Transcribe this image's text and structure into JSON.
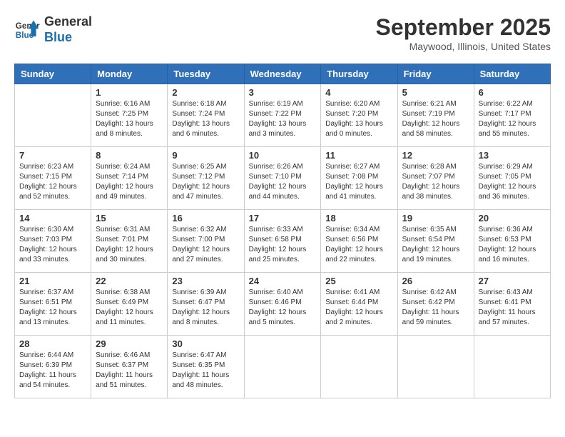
{
  "logo": {
    "line1": "General",
    "line2": "Blue"
  },
  "title": "September 2025",
  "location": "Maywood, Illinois, United States",
  "days_of_week": [
    "Sunday",
    "Monday",
    "Tuesday",
    "Wednesday",
    "Thursday",
    "Friday",
    "Saturday"
  ],
  "weeks": [
    [
      {
        "day": "",
        "info": ""
      },
      {
        "day": "1",
        "info": "Sunrise: 6:16 AM\nSunset: 7:25 PM\nDaylight: 13 hours\nand 8 minutes."
      },
      {
        "day": "2",
        "info": "Sunrise: 6:18 AM\nSunset: 7:24 PM\nDaylight: 13 hours\nand 6 minutes."
      },
      {
        "day": "3",
        "info": "Sunrise: 6:19 AM\nSunset: 7:22 PM\nDaylight: 13 hours\nand 3 minutes."
      },
      {
        "day": "4",
        "info": "Sunrise: 6:20 AM\nSunset: 7:20 PM\nDaylight: 13 hours\nand 0 minutes."
      },
      {
        "day": "5",
        "info": "Sunrise: 6:21 AM\nSunset: 7:19 PM\nDaylight: 12 hours\nand 58 minutes."
      },
      {
        "day": "6",
        "info": "Sunrise: 6:22 AM\nSunset: 7:17 PM\nDaylight: 12 hours\nand 55 minutes."
      }
    ],
    [
      {
        "day": "7",
        "info": "Sunrise: 6:23 AM\nSunset: 7:15 PM\nDaylight: 12 hours\nand 52 minutes."
      },
      {
        "day": "8",
        "info": "Sunrise: 6:24 AM\nSunset: 7:14 PM\nDaylight: 12 hours\nand 49 minutes."
      },
      {
        "day": "9",
        "info": "Sunrise: 6:25 AM\nSunset: 7:12 PM\nDaylight: 12 hours\nand 47 minutes."
      },
      {
        "day": "10",
        "info": "Sunrise: 6:26 AM\nSunset: 7:10 PM\nDaylight: 12 hours\nand 44 minutes."
      },
      {
        "day": "11",
        "info": "Sunrise: 6:27 AM\nSunset: 7:08 PM\nDaylight: 12 hours\nand 41 minutes."
      },
      {
        "day": "12",
        "info": "Sunrise: 6:28 AM\nSunset: 7:07 PM\nDaylight: 12 hours\nand 38 minutes."
      },
      {
        "day": "13",
        "info": "Sunrise: 6:29 AM\nSunset: 7:05 PM\nDaylight: 12 hours\nand 36 minutes."
      }
    ],
    [
      {
        "day": "14",
        "info": "Sunrise: 6:30 AM\nSunset: 7:03 PM\nDaylight: 12 hours\nand 33 minutes."
      },
      {
        "day": "15",
        "info": "Sunrise: 6:31 AM\nSunset: 7:01 PM\nDaylight: 12 hours\nand 30 minutes."
      },
      {
        "day": "16",
        "info": "Sunrise: 6:32 AM\nSunset: 7:00 PM\nDaylight: 12 hours\nand 27 minutes."
      },
      {
        "day": "17",
        "info": "Sunrise: 6:33 AM\nSunset: 6:58 PM\nDaylight: 12 hours\nand 25 minutes."
      },
      {
        "day": "18",
        "info": "Sunrise: 6:34 AM\nSunset: 6:56 PM\nDaylight: 12 hours\nand 22 minutes."
      },
      {
        "day": "19",
        "info": "Sunrise: 6:35 AM\nSunset: 6:54 PM\nDaylight: 12 hours\nand 19 minutes."
      },
      {
        "day": "20",
        "info": "Sunrise: 6:36 AM\nSunset: 6:53 PM\nDaylight: 12 hours\nand 16 minutes."
      }
    ],
    [
      {
        "day": "21",
        "info": "Sunrise: 6:37 AM\nSunset: 6:51 PM\nDaylight: 12 hours\nand 13 minutes."
      },
      {
        "day": "22",
        "info": "Sunrise: 6:38 AM\nSunset: 6:49 PM\nDaylight: 12 hours\nand 11 minutes."
      },
      {
        "day": "23",
        "info": "Sunrise: 6:39 AM\nSunset: 6:47 PM\nDaylight: 12 hours\nand 8 minutes."
      },
      {
        "day": "24",
        "info": "Sunrise: 6:40 AM\nSunset: 6:46 PM\nDaylight: 12 hours\nand 5 minutes."
      },
      {
        "day": "25",
        "info": "Sunrise: 6:41 AM\nSunset: 6:44 PM\nDaylight: 12 hours\nand 2 minutes."
      },
      {
        "day": "26",
        "info": "Sunrise: 6:42 AM\nSunset: 6:42 PM\nDaylight: 11 hours\nand 59 minutes."
      },
      {
        "day": "27",
        "info": "Sunrise: 6:43 AM\nSunset: 6:41 PM\nDaylight: 11 hours\nand 57 minutes."
      }
    ],
    [
      {
        "day": "28",
        "info": "Sunrise: 6:44 AM\nSunset: 6:39 PM\nDaylight: 11 hours\nand 54 minutes."
      },
      {
        "day": "29",
        "info": "Sunrise: 6:46 AM\nSunset: 6:37 PM\nDaylight: 11 hours\nand 51 minutes."
      },
      {
        "day": "30",
        "info": "Sunrise: 6:47 AM\nSunset: 6:35 PM\nDaylight: 11 hours\nand 48 minutes."
      },
      {
        "day": "",
        "info": ""
      },
      {
        "day": "",
        "info": ""
      },
      {
        "day": "",
        "info": ""
      },
      {
        "day": "",
        "info": ""
      }
    ]
  ]
}
